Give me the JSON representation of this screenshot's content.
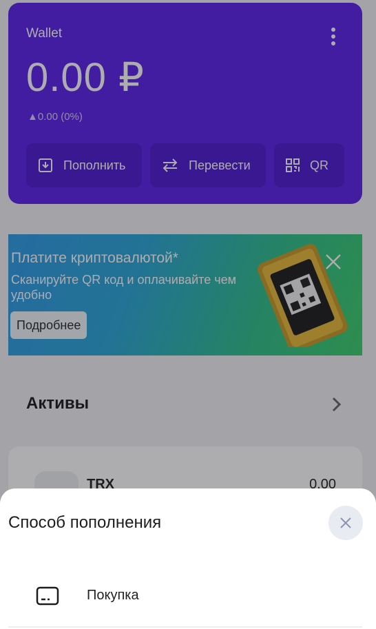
{
  "wallet": {
    "title": "Wallet",
    "balance": "0.00 ₽",
    "change": "▲0.00 (0%)",
    "actions": {
      "topup": "Пополнить",
      "transfer": "Перевести",
      "qr": "QR"
    },
    "accent_color": "#5b22ea"
  },
  "banner": {
    "title": "Платите криптовалютой*",
    "text": "Сканируйте QR код и оплачивайте чем удобно",
    "more_label": "Подробнее"
  },
  "assets": {
    "header": "Активы",
    "items": [
      {
        "name": "TRX",
        "value": "0.00"
      }
    ]
  },
  "sheet": {
    "title": "Способ пополнения",
    "methods": [
      {
        "label": "Покупка",
        "icon": "card-icon"
      }
    ]
  }
}
